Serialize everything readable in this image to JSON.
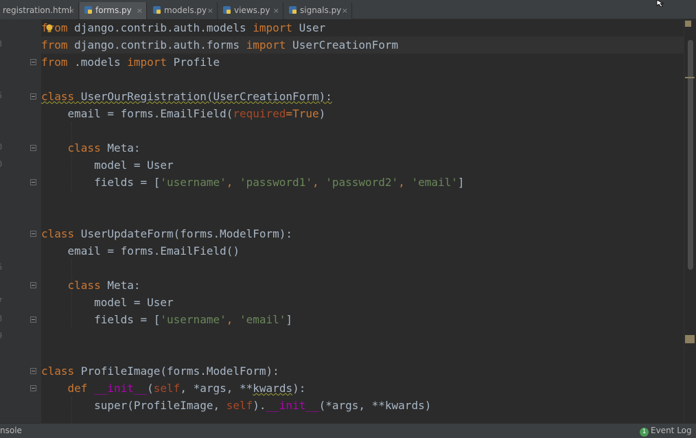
{
  "tabs": [
    {
      "label": "registration.html",
      "icon": "html-file-icon",
      "close": "×",
      "active": false
    },
    {
      "label": "forms.py",
      "icon": "python-file-icon",
      "close": "×",
      "active": true
    },
    {
      "label": "models.py",
      "icon": "python-file-icon",
      "close": "×",
      "active": false
    },
    {
      "label": "views.py",
      "icon": "python-file-icon",
      "close": "×",
      "active": false
    },
    {
      "label": "signals.py",
      "icon": "python-file-icon",
      "close": "×",
      "active": false
    }
  ],
  "code": {
    "l1": {
      "a": "from",
      "b": " django.contrib.auth.models ",
      "c": "import",
      "d": " User"
    },
    "l2": {
      "a": "from",
      "b": " django.contrib.auth.forms ",
      "c": "import",
      "d": " UserCreationForm"
    },
    "l3": {
      "a": "from",
      "b": " .models ",
      "c": "import",
      "d": " Profile"
    },
    "l5": {
      "a": "class",
      "b": " UserOurRegistration(UserCreationForm):"
    },
    "l6": {
      "a": "    email = forms.EmailField(",
      "b": "required",
      "c": "=",
      "d": "True",
      "e": ")"
    },
    "l8": {
      "a": "    ",
      "b": "class",
      "c": " Meta:"
    },
    "l9": {
      "a": "        model = User"
    },
    "l10": {
      "a": "        fields = [",
      "b": "'username'",
      "c": ", ",
      "d": "'password1'",
      "e": ", ",
      "f": "'password2'",
      "g": ", ",
      "h": "'email'",
      "i": "]"
    },
    "l13": {
      "a": "class",
      "b": " UserUpdateForm(forms.ModelForm):"
    },
    "l14": {
      "a": "    email = forms.EmailField()"
    },
    "l16": {
      "a": "    ",
      "b": "class",
      "c": " Meta:"
    },
    "l17": {
      "a": "        model = User"
    },
    "l18": {
      "a": "        fields = [",
      "b": "'username'",
      "c": ", ",
      "d": "'email'",
      "e": "]"
    },
    "l21": {
      "a": "class",
      "b": " ProfileImage(forms.ModelForm):"
    },
    "l22": {
      "a": "    ",
      "b": "def",
      "c": " ",
      "d": "__init__",
      "e": "(",
      "f": "self",
      "g": ", *args, **",
      "h": "kwards",
      "i": "):"
    },
    "l23": {
      "a": "        super(ProfileImage, ",
      "b": "self",
      "c": ").",
      "d": "__init__",
      "e": "(*args, **kwards)"
    }
  },
  "gutter_numbers": [
    "",
    "3",
    "",
    "",
    "5",
    "",
    "",
    "0",
    "0",
    "",
    "",
    "",
    "",
    "",
    "5",
    "",
    "7",
    "8",
    "9",
    "",
    "",
    "",
    "",
    ""
  ],
  "statusbar": {
    "console_label": "nsole",
    "event_log_label": "Event Log",
    "event_log_count": "1"
  },
  "colors": {
    "keyword": "#cc7832",
    "string": "#6a8759",
    "identifier": "#a9b7c6",
    "param": "#aa4926",
    "dunder": "#b200b2",
    "background": "#2b2b2b",
    "event_badge": "#499c54"
  }
}
